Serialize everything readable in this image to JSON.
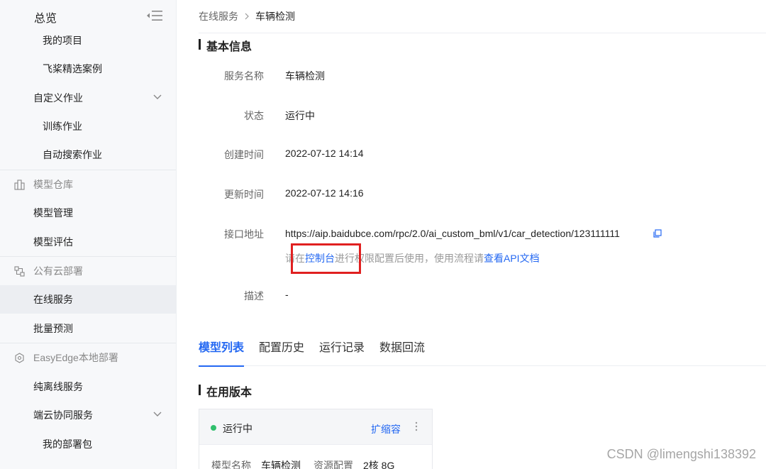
{
  "sidebar": {
    "overview": "总览",
    "items": [
      {
        "label": "我的项目",
        "kind": "l2"
      },
      {
        "label": "飞桨精选案例",
        "kind": "l2"
      },
      {
        "label": "自定义作业",
        "kind": "l1"
      },
      {
        "label": "训练作业",
        "kind": "l2"
      },
      {
        "label": "自动搜索作业",
        "kind": "l2"
      },
      {
        "label": "模型仓库",
        "kind": "group"
      },
      {
        "label": "模型管理",
        "kind": "l1"
      },
      {
        "label": "模型评估",
        "kind": "l1"
      },
      {
        "label": "公有云部署",
        "kind": "group"
      },
      {
        "label": "在线服务",
        "kind": "l1"
      },
      {
        "label": "批量预测",
        "kind": "l1"
      },
      {
        "label": "EasyEdge本地部署",
        "kind": "group"
      },
      {
        "label": "纯离线服务",
        "kind": "l1"
      },
      {
        "label": "端云协同服务",
        "kind": "l1"
      },
      {
        "label": "我的部署包",
        "kind": "l2"
      }
    ]
  },
  "breadcrumb": {
    "parent": "在线服务",
    "current": "车辆检测"
  },
  "basic_info": {
    "title": "基本信息",
    "rows": [
      {
        "label": "服务名称",
        "value": "车辆检测"
      },
      {
        "label": "状态",
        "value": "运行中"
      },
      {
        "label": "创建时间",
        "value": "2022-07-12 14:14"
      },
      {
        "label": "更新时间",
        "value": "2022-07-12 14:16"
      },
      {
        "label": "接口地址",
        "value": "https://aip.baidubce.com/rpc/2.0/ai_custom_bml/v1/car_detection/123111111"
      },
      {
        "label": "描述",
        "value": "-"
      }
    ],
    "hint": {
      "prefix": "请在",
      "console_link": "控制台",
      "middle": "进行权限配置后使用，使用流程请",
      "doc_link": "查看API文档"
    }
  },
  "tabs": [
    "模型列表",
    "配置历史",
    "运行记录",
    "数据回流"
  ],
  "active_tab": "模型列表",
  "versions": {
    "title": "在用版本",
    "card": {
      "status": "运行中",
      "scale_link": "扩缩容",
      "model_name_label": "模型名称",
      "model_name": "车辆检测",
      "resource_label": "资源配置",
      "resource": "2核 8G"
    }
  },
  "watermark": "CSDN @limengshi138392",
  "colors": {
    "accent": "#2468f2",
    "running": "#30bf6c",
    "highlight_box": "#e02020"
  }
}
